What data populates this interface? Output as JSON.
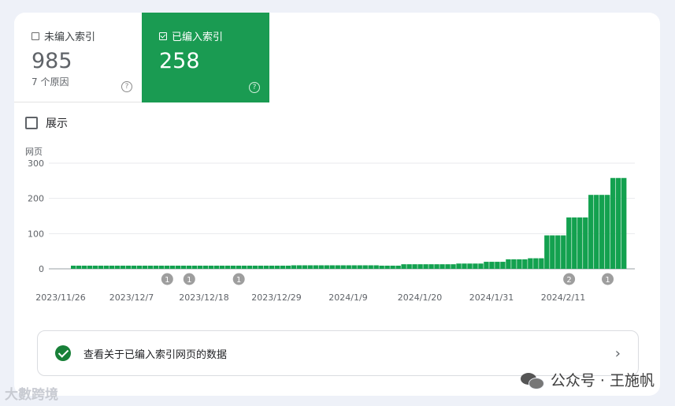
{
  "tiles": {
    "unindexed": {
      "label": "未编入索引",
      "value": "985",
      "sub": "7 个原因",
      "selected": false
    },
    "indexed": {
      "label": "已编入索引",
      "value": "258",
      "selected": true
    }
  },
  "impressions_label": "展示",
  "colors": {
    "accent": "#1a9b52",
    "bar": "#13a14f",
    "check": "#188038"
  },
  "chart_data": {
    "type": "bar",
    "ylabel": "网页",
    "ylim": [
      0,
      300
    ],
    "yticks": [
      "0",
      "100",
      "200",
      "300"
    ],
    "x_tick_labels": [
      "2023/11/26",
      "2023/12/7",
      "2023/12/18",
      "2023/12/29",
      "2024/1/9",
      "2024/1/20",
      "2024/1/31",
      "2024/2/11"
    ],
    "values": [
      9,
      9,
      9,
      9,
      9,
      9,
      9,
      9,
      9,
      9,
      9,
      9,
      9,
      9,
      9,
      9,
      9,
      9,
      9,
      9,
      9,
      9,
      9,
      9,
      9,
      9,
      9,
      9,
      9,
      9,
      9,
      9,
      9,
      9,
      9,
      9,
      9,
      9,
      9,
      9,
      10,
      10,
      10,
      10,
      10,
      10,
      10,
      10,
      10,
      10,
      10,
      10,
      10,
      10,
      10,
      10,
      9,
      9,
      9,
      9,
      13,
      13,
      13,
      13,
      13,
      13,
      13,
      13,
      13,
      13,
      15,
      15,
      15,
      15,
      15,
      20,
      20,
      20,
      20,
      27,
      27,
      27,
      27,
      30,
      30,
      30,
      95,
      95,
      95,
      95,
      146,
      146,
      146,
      146,
      210,
      210,
      210,
      210,
      258,
      258,
      258
    ],
    "annotations": [
      {
        "label": "1",
        "index": 17
      },
      {
        "label": "1",
        "index": 21
      },
      {
        "label": "1",
        "index": 30
      },
      {
        "label": "2",
        "index": 90
      },
      {
        "label": "1",
        "index": 97
      }
    ]
  },
  "notice": {
    "text": "查看关于已编入索引网页的数据",
    "chevron": "›"
  },
  "watermarks": {
    "right": "公众号 · 王施帆",
    "left": "大數跨境"
  }
}
